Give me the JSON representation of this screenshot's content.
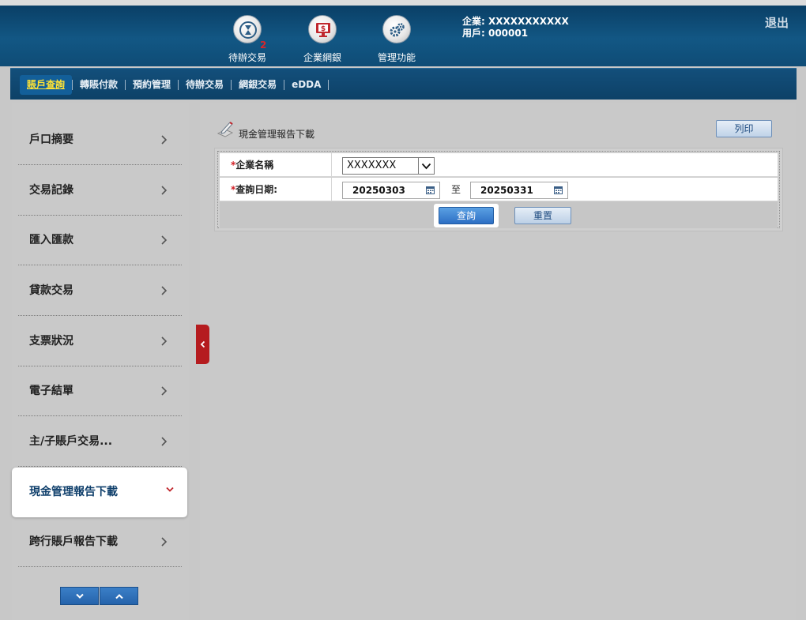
{
  "header": {
    "buttons": [
      {
        "label": "待辦交易",
        "badge": "2"
      },
      {
        "label": "企業網銀"
      },
      {
        "label": "管理功能"
      }
    ],
    "user": {
      "company_line": "企業: XXXXXXXXXXX",
      "user_line": "用戶: 000001"
    },
    "logout_label": "退出"
  },
  "nav": {
    "items": [
      "賬戶查詢",
      "轉賬付款",
      "預約管理",
      "待辦交易",
      "網銀交易",
      "eDDA"
    ],
    "active_index": 0
  },
  "sidebar": {
    "items": [
      {
        "label": "戶口摘要"
      },
      {
        "label": "交易記錄"
      },
      {
        "label": "匯入匯款"
      },
      {
        "label": "貸款交易"
      },
      {
        "label": "支票狀況"
      },
      {
        "label": "電子結單"
      },
      {
        "label": "主/子賬戶交易..."
      },
      {
        "label": "現金管理報告下載",
        "active": true
      },
      {
        "label": "跨行賬戶報告下載"
      }
    ]
  },
  "main": {
    "page_title": "現金管理報告下載",
    "print_label": "列印",
    "form": {
      "company_label": "企業名稱",
      "company_value": "XXXXXXX",
      "date_label": "查詢日期:",
      "date_from": "20250303",
      "date_to_label": "至",
      "date_to": "20250331",
      "required_mark": "*"
    },
    "query_label": "查詢",
    "reset_label": "重置"
  },
  "colors": {
    "header_bg": "#125784",
    "nav_active_text": "#ffe335",
    "required": "#d11f25",
    "collapse_tab": "#b51c1f",
    "primary_button": "#2d6fc4"
  }
}
